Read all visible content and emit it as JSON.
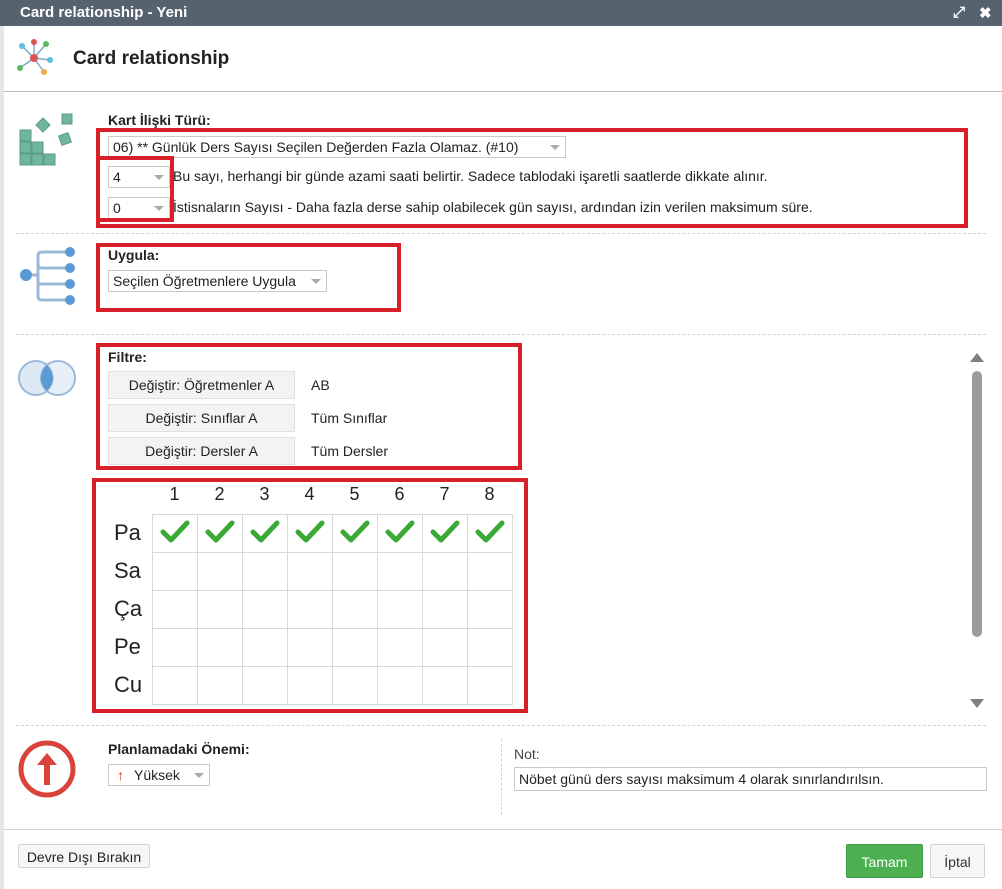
{
  "window": {
    "title": "Card relationship - Yeni",
    "controls": [
      "expand-icon",
      "close-icon"
    ]
  },
  "header": {
    "title": "Card relationship"
  },
  "relation_type": {
    "label": "Kart İlişki Türü:",
    "selected": "06) ** Günlük Ders Sayısı Seçilen Değerden Fazla Olamaz. (#10)",
    "param1": {
      "value": "4",
      "description": "Bu sayı, herhangi bir günde azami saati belirtir. Sadece tablodaki işaretli saatlerde dikkate alınır."
    },
    "param2": {
      "value": "0",
      "description": "İstisnaların Sayısı - Daha fazla derse sahip olabilecek gün sayısı, ardından izin verilen maksimum süre."
    }
  },
  "apply": {
    "label": "Uygula:",
    "selected": "Seçilen Öğretmenlere Uygula"
  },
  "filter": {
    "label": "Filtre:",
    "rows": [
      {
        "button": "Değiştir: Öğretmenler A",
        "value": "AB"
      },
      {
        "button": "Değiştir: Sınıflar A",
        "value": "Tüm Sınıflar"
      },
      {
        "button": "Değiştir: Dersler A",
        "value": "Tüm Dersler"
      }
    ]
  },
  "timetable": {
    "columns": [
      "1",
      "2",
      "3",
      "4",
      "5",
      "6",
      "7",
      "8"
    ],
    "rows": [
      "Pa",
      "Sa",
      "Ça",
      "Pe",
      "Cu"
    ],
    "checked": [
      [
        true,
        true,
        true,
        true,
        true,
        true,
        true,
        true
      ],
      [
        false,
        false,
        false,
        false,
        false,
        false,
        false,
        false
      ],
      [
        false,
        false,
        false,
        false,
        false,
        false,
        false,
        false
      ],
      [
        false,
        false,
        false,
        false,
        false,
        false,
        false,
        false
      ],
      [
        false,
        false,
        false,
        false,
        false,
        false,
        false,
        false
      ]
    ],
    "check_color": "#3aa935"
  },
  "importance": {
    "label": "Planlamadaki Önemi:",
    "selected": "Yüksek",
    "icon": "arrow-up-icon",
    "color": "#d9433a"
  },
  "note": {
    "label": "Not:",
    "value": "Nöbet günü ders sayısı maksimum 4 olarak sınırlandırılsın."
  },
  "footer": {
    "disable_label": "Devre Dışı Bırakın",
    "ok_label": "Tamam",
    "cancel_label": "İptal",
    "ok_color": "#4caf50"
  },
  "highlight_color": "#d8202a"
}
